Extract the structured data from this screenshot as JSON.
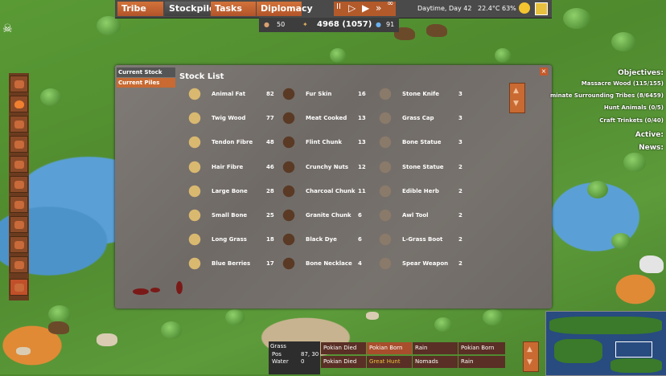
{
  "top_tabs": [
    "Tribe",
    "Stockpiles",
    "Tasks",
    "Diplomacy"
  ],
  "speed_controls": {
    "pause": "II",
    "play": "▷",
    "fast": "▶",
    "faster": "»",
    "max": "∞"
  },
  "status": {
    "daytime": "Daytime, Day 42",
    "temperature": "22.4°C",
    "humidity": "63%"
  },
  "resources": {
    "population": "50",
    "food": "4968 (1057)",
    "water": "91"
  },
  "panel": {
    "tabs": [
      "Current Stock",
      "Current Piles"
    ],
    "title": "Stock List",
    "close": "×",
    "scroll_up": "▲",
    "scroll_down": "▼",
    "columns": [
      [
        {
          "name": "Animal Fat",
          "count": "82",
          "icon": "animal-fat-icon"
        },
        {
          "name": "Twig Wood",
          "count": "77",
          "icon": "twig-wood-icon"
        },
        {
          "name": "Tendon Fibre",
          "count": "48",
          "icon": "tendon-fibre-icon"
        },
        {
          "name": "Hair Fibre",
          "count": "46",
          "icon": "hair-fibre-icon"
        },
        {
          "name": "Large Bone",
          "count": "28",
          "icon": "large-bone-icon"
        },
        {
          "name": "Small Bone",
          "count": "25",
          "icon": "small-bone-icon"
        },
        {
          "name": "Long Grass",
          "count": "18",
          "icon": "long-grass-icon"
        },
        {
          "name": "Blue Berries",
          "count": "17",
          "icon": "blue-berries-icon"
        }
      ],
      [
        {
          "name": "Fur Skin",
          "count": "16",
          "icon": "fur-skin-icon"
        },
        {
          "name": "Meat Cooked",
          "count": "13",
          "icon": "meat-cooked-icon"
        },
        {
          "name": "Flint Chunk",
          "count": "13",
          "icon": "flint-chunk-icon"
        },
        {
          "name": "Crunchy Nuts",
          "count": "12",
          "icon": "crunchy-nuts-icon"
        },
        {
          "name": "Charcoal Chunk",
          "count": "11",
          "icon": "charcoal-chunk-icon"
        },
        {
          "name": "Granite Chunk",
          "count": "6",
          "icon": "granite-chunk-icon"
        },
        {
          "name": "Black Dye",
          "count": "6",
          "icon": "black-dye-icon"
        },
        {
          "name": "Bone Necklace",
          "count": "4",
          "icon": "bone-necklace-icon"
        }
      ],
      [
        {
          "name": "Stone Knife",
          "count": "3",
          "icon": "stone-knife-icon"
        },
        {
          "name": "Grass Cap",
          "count": "3",
          "icon": "grass-cap-icon"
        },
        {
          "name": "Bone Statue",
          "count": "3",
          "icon": "bone-statue-icon"
        },
        {
          "name": "Stone Statue",
          "count": "2",
          "icon": "stone-statue-icon"
        },
        {
          "name": "Edible Herb",
          "count": "2",
          "icon": "edible-herb-icon"
        },
        {
          "name": "Awl Tool",
          "count": "2",
          "icon": "awl-tool-icon"
        },
        {
          "name": "L-Grass Boot",
          "count": "2",
          "icon": "grass-boot-icon"
        },
        {
          "name": "Spear Weapon",
          "count": "2",
          "icon": "spear-weapon-icon"
        }
      ]
    ]
  },
  "objectives": {
    "title": "Objectives:",
    "items": [
      "Massacre Wood (115/155)",
      "minate Surrounding Tribes (8/6459)",
      "Hunt Animals (0/5)",
      "Craft Trinkets (0/40)"
    ],
    "active_label": "Active:",
    "news_label": "News:"
  },
  "tile_info": {
    "terrain": "Grass",
    "pos_label": "Pos",
    "pos_value": "87, 30",
    "water_label": "Water",
    "water_value": "0"
  },
  "events": [
    [
      "Pokian Died",
      "Pokian Born",
      "Rain",
      "Pokian Born"
    ],
    [
      "Pokian Died",
      "Great Hunt",
      "Nomads",
      "Rain"
    ]
  ],
  "colors": {
    "accent": "#c86a32",
    "panel": "#77726d",
    "highlight": "#f0c040"
  }
}
